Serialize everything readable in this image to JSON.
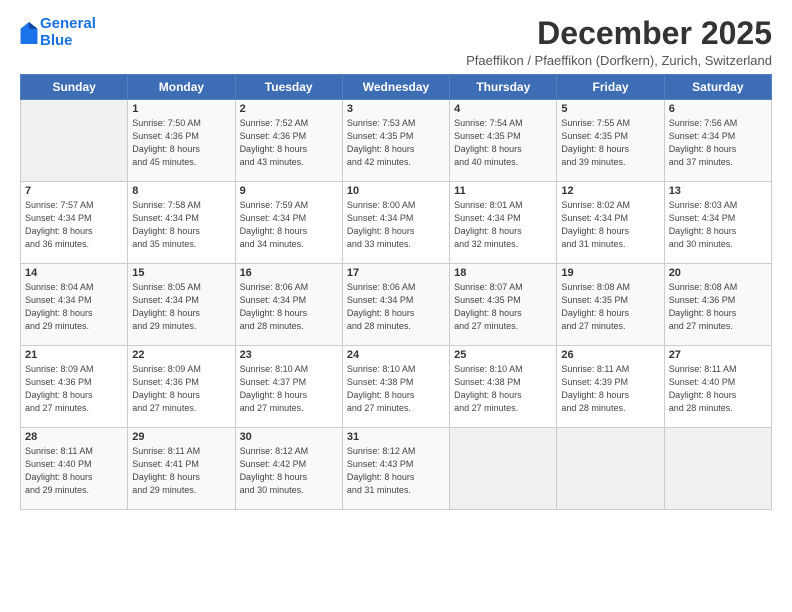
{
  "logo": {
    "line1": "General",
    "line2": "Blue"
  },
  "title": "December 2025",
  "subtitle": "Pfaeffikon / Pfaeffikon (Dorfkern), Zurich, Switzerland",
  "days_of_week": [
    "Sunday",
    "Monday",
    "Tuesday",
    "Wednesday",
    "Thursday",
    "Friday",
    "Saturday"
  ],
  "weeks": [
    [
      {
        "day": "",
        "info": ""
      },
      {
        "day": "1",
        "info": "Sunrise: 7:50 AM\nSunset: 4:36 PM\nDaylight: 8 hours\nand 45 minutes."
      },
      {
        "day": "2",
        "info": "Sunrise: 7:52 AM\nSunset: 4:36 PM\nDaylight: 8 hours\nand 43 minutes."
      },
      {
        "day": "3",
        "info": "Sunrise: 7:53 AM\nSunset: 4:35 PM\nDaylight: 8 hours\nand 42 minutes."
      },
      {
        "day": "4",
        "info": "Sunrise: 7:54 AM\nSunset: 4:35 PM\nDaylight: 8 hours\nand 40 minutes."
      },
      {
        "day": "5",
        "info": "Sunrise: 7:55 AM\nSunset: 4:35 PM\nDaylight: 8 hours\nand 39 minutes."
      },
      {
        "day": "6",
        "info": "Sunrise: 7:56 AM\nSunset: 4:34 PM\nDaylight: 8 hours\nand 37 minutes."
      }
    ],
    [
      {
        "day": "7",
        "info": "Sunrise: 7:57 AM\nSunset: 4:34 PM\nDaylight: 8 hours\nand 36 minutes."
      },
      {
        "day": "8",
        "info": "Sunrise: 7:58 AM\nSunset: 4:34 PM\nDaylight: 8 hours\nand 35 minutes."
      },
      {
        "day": "9",
        "info": "Sunrise: 7:59 AM\nSunset: 4:34 PM\nDaylight: 8 hours\nand 34 minutes."
      },
      {
        "day": "10",
        "info": "Sunrise: 8:00 AM\nSunset: 4:34 PM\nDaylight: 8 hours\nand 33 minutes."
      },
      {
        "day": "11",
        "info": "Sunrise: 8:01 AM\nSunset: 4:34 PM\nDaylight: 8 hours\nand 32 minutes."
      },
      {
        "day": "12",
        "info": "Sunrise: 8:02 AM\nSunset: 4:34 PM\nDaylight: 8 hours\nand 31 minutes."
      },
      {
        "day": "13",
        "info": "Sunrise: 8:03 AM\nSunset: 4:34 PM\nDaylight: 8 hours\nand 30 minutes."
      }
    ],
    [
      {
        "day": "14",
        "info": "Sunrise: 8:04 AM\nSunset: 4:34 PM\nDaylight: 8 hours\nand 29 minutes."
      },
      {
        "day": "15",
        "info": "Sunrise: 8:05 AM\nSunset: 4:34 PM\nDaylight: 8 hours\nand 29 minutes."
      },
      {
        "day": "16",
        "info": "Sunrise: 8:06 AM\nSunset: 4:34 PM\nDaylight: 8 hours\nand 28 minutes."
      },
      {
        "day": "17",
        "info": "Sunrise: 8:06 AM\nSunset: 4:34 PM\nDaylight: 8 hours\nand 28 minutes."
      },
      {
        "day": "18",
        "info": "Sunrise: 8:07 AM\nSunset: 4:35 PM\nDaylight: 8 hours\nand 27 minutes."
      },
      {
        "day": "19",
        "info": "Sunrise: 8:08 AM\nSunset: 4:35 PM\nDaylight: 8 hours\nand 27 minutes."
      },
      {
        "day": "20",
        "info": "Sunrise: 8:08 AM\nSunset: 4:36 PM\nDaylight: 8 hours\nand 27 minutes."
      }
    ],
    [
      {
        "day": "21",
        "info": "Sunrise: 8:09 AM\nSunset: 4:36 PM\nDaylight: 8 hours\nand 27 minutes."
      },
      {
        "day": "22",
        "info": "Sunrise: 8:09 AM\nSunset: 4:36 PM\nDaylight: 8 hours\nand 27 minutes."
      },
      {
        "day": "23",
        "info": "Sunrise: 8:10 AM\nSunset: 4:37 PM\nDaylight: 8 hours\nand 27 minutes."
      },
      {
        "day": "24",
        "info": "Sunrise: 8:10 AM\nSunset: 4:38 PM\nDaylight: 8 hours\nand 27 minutes."
      },
      {
        "day": "25",
        "info": "Sunrise: 8:10 AM\nSunset: 4:38 PM\nDaylight: 8 hours\nand 27 minutes."
      },
      {
        "day": "26",
        "info": "Sunrise: 8:11 AM\nSunset: 4:39 PM\nDaylight: 8 hours\nand 28 minutes."
      },
      {
        "day": "27",
        "info": "Sunrise: 8:11 AM\nSunset: 4:40 PM\nDaylight: 8 hours\nand 28 minutes."
      }
    ],
    [
      {
        "day": "28",
        "info": "Sunrise: 8:11 AM\nSunset: 4:40 PM\nDaylight: 8 hours\nand 29 minutes."
      },
      {
        "day": "29",
        "info": "Sunrise: 8:11 AM\nSunset: 4:41 PM\nDaylight: 8 hours\nand 29 minutes."
      },
      {
        "day": "30",
        "info": "Sunrise: 8:12 AM\nSunset: 4:42 PM\nDaylight: 8 hours\nand 30 minutes."
      },
      {
        "day": "31",
        "info": "Sunrise: 8:12 AM\nSunset: 4:43 PM\nDaylight: 8 hours\nand 31 minutes."
      },
      {
        "day": "",
        "info": ""
      },
      {
        "day": "",
        "info": ""
      },
      {
        "day": "",
        "info": ""
      }
    ]
  ]
}
